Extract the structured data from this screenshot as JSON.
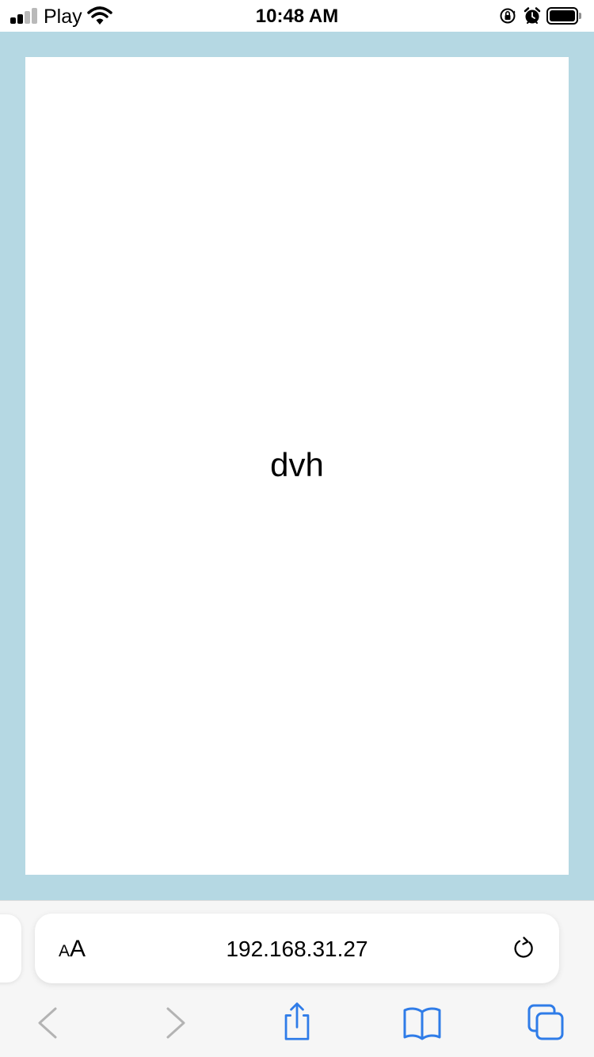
{
  "status_bar": {
    "carrier": "Play",
    "time": "10:48 AM"
  },
  "page": {
    "text": "dvh",
    "background_color": "#b5d8e3",
    "box_color": "#ffffff"
  },
  "browser": {
    "text_size_small": "A",
    "text_size_large": "A",
    "url": "192.168.31.27",
    "accent_color": "#2f7ce8",
    "disabled_color": "#b3b3b3"
  },
  "icons": {
    "signal": "cellular-signal-icon",
    "wifi": "wifi-icon",
    "orientation_lock": "orientation-lock-icon",
    "alarm": "alarm-icon",
    "battery": "battery-icon",
    "reload": "reload-icon",
    "back": "chevron-left-icon",
    "forward": "chevron-right-icon",
    "share": "share-icon",
    "bookmarks": "book-icon",
    "tabs": "tabs-icon"
  }
}
